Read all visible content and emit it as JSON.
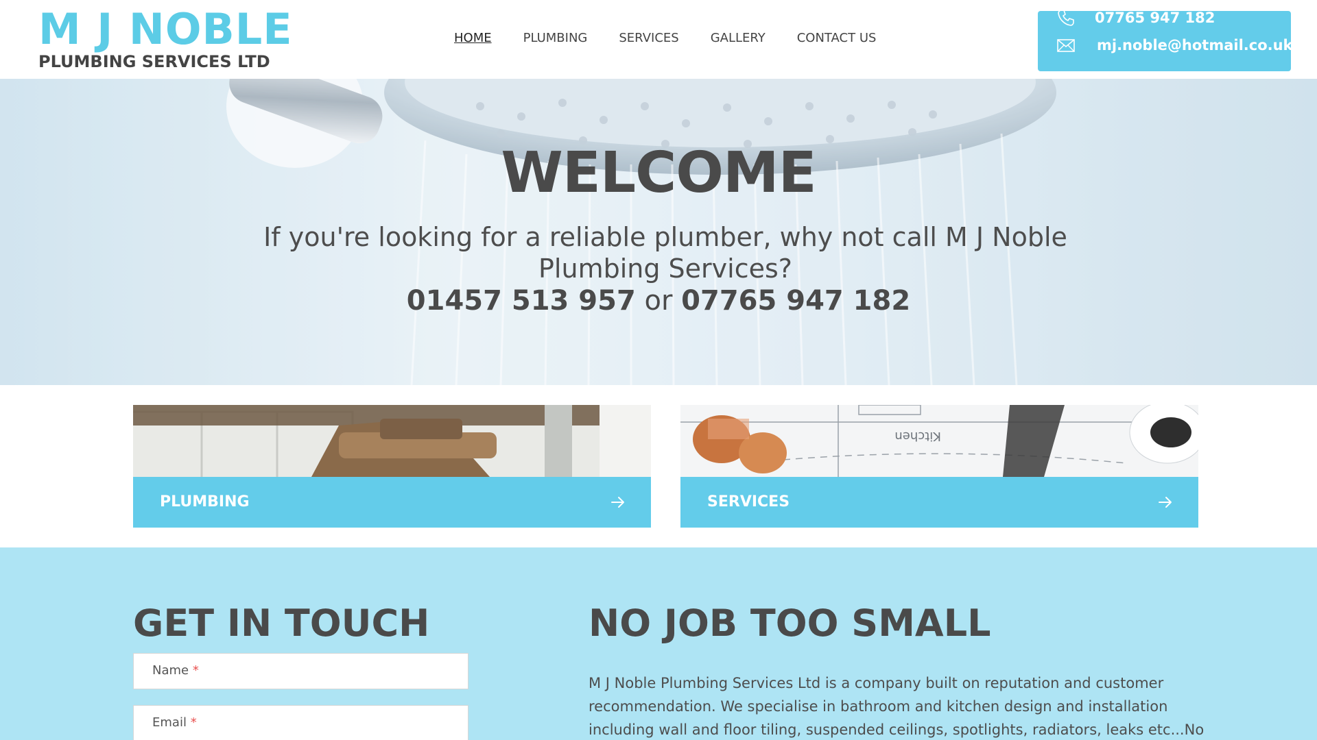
{
  "header": {
    "logo_title": "M J NOBLE",
    "logo_subtitle": "PLUMBING SERVICES LTD",
    "nav": [
      {
        "label": "HOME",
        "active": true
      },
      {
        "label": "PLUMBING",
        "active": false
      },
      {
        "label": "SERVICES",
        "active": false
      },
      {
        "label": "GALLERY",
        "active": false
      },
      {
        "label": "CONTACT US",
        "active": false
      }
    ],
    "contact": {
      "phone": "07765 947 182",
      "phone_icon": "phone-icon",
      "email": "mj.noble@hotmail.co.uk",
      "email_icon": "envelope-icon"
    }
  },
  "hero": {
    "title": "WELCOME",
    "text": "If you're looking for a reliable plumber, why not call M J Noble Plumbing Services?",
    "phone_1": "01457 513 957",
    "connector": " or ",
    "phone_2": "07765 947 182"
  },
  "cards": [
    {
      "label": "PLUMBING",
      "arrow_icon": "arrow-right-icon"
    },
    {
      "label": "SERVICES",
      "arrow_icon": "arrow-right-icon"
    }
  ],
  "get_in_touch": {
    "title": "GET IN TOUCH",
    "name_label": "Name",
    "email_label": "Email",
    "required_mark": "*"
  },
  "no_job": {
    "title": "NO JOB TOO SMALL",
    "text": "M J Noble Plumbing Services Ltd is a company built on reputation and customer recommendation. We specialise in bathroom and kitchen design and installation including wall and floor tiling, suspended ceilings, spotlights, radiators, leaks etc...No"
  },
  "colors": {
    "accent": "#63ccea",
    "logo": "#5ccce6",
    "bottom_bg": "#aee4f4",
    "text": "#4a4a4a",
    "required": "#e8504f"
  }
}
